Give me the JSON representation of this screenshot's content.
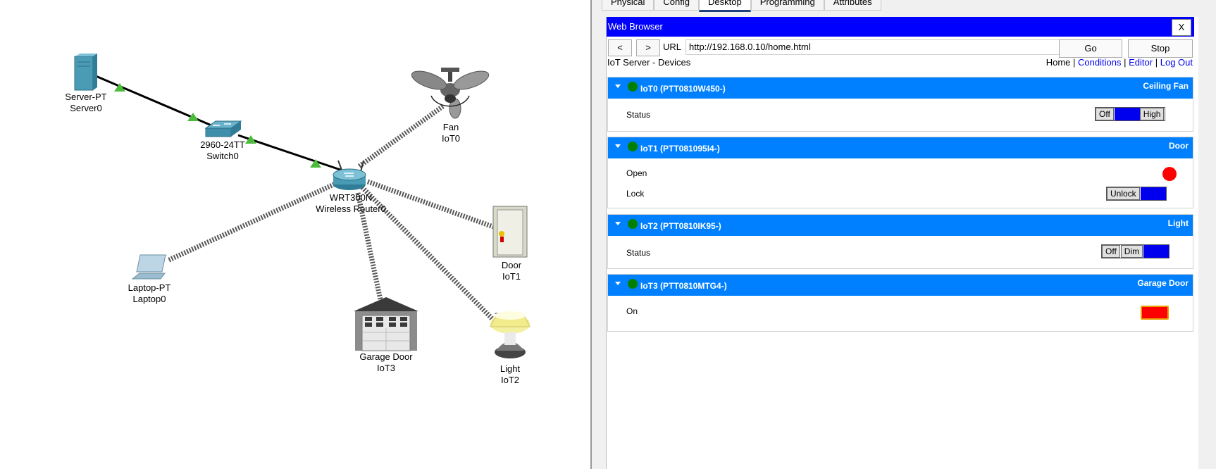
{
  "topology": {
    "devices": [
      {
        "id": "server",
        "model": "Server-PT",
        "name": "Server0"
      },
      {
        "id": "switch",
        "model": "2960-24TT",
        "name": "Switch0"
      },
      {
        "id": "router",
        "model": "WRT300N",
        "name": "Wireless Router0"
      },
      {
        "id": "fan",
        "model": "Fan",
        "name": "IoT0"
      },
      {
        "id": "door",
        "model": "Door",
        "name": "IoT1"
      },
      {
        "id": "light",
        "model": "Light",
        "name": "IoT2"
      },
      {
        "id": "garage",
        "model": "Garage Door",
        "name": "IoT3"
      },
      {
        "id": "laptop",
        "model": "Laptop-PT",
        "name": "Laptop0"
      }
    ],
    "link_up_color": "#4cbb3c"
  },
  "tabs": [
    "Physical",
    "Config",
    "Desktop",
    "Programming",
    "Attributes"
  ],
  "active_tab": "Desktop",
  "browser": {
    "title": "Web Browser",
    "close_label": "X",
    "back_label": "<",
    "forward_label": ">",
    "url_label": "URL",
    "url": "http://192.168.0.10/home.html",
    "go_label": "Go",
    "stop_label": "Stop",
    "title_bar_color": "#0000ff"
  },
  "page": {
    "title": "IoT Server - Devices",
    "links": [
      "Home",
      "Conditions",
      "Editor",
      "Log Out"
    ],
    "separator": "|",
    "header_color": "#0080ff",
    "devices": [
      {
        "name": "IoT0 (PTT0810W450-)",
        "type": "Ceiling Fan",
        "props": [
          {
            "label": "Status",
            "options": [
              "Off",
              "High"
            ]
          }
        ]
      },
      {
        "name": "IoT1 (PTT081095I4-)",
        "type": "Door",
        "props": [
          {
            "label": "Open"
          },
          {
            "label": "Lock",
            "options": [
              "Unlock"
            ]
          }
        ]
      },
      {
        "name": "IoT2 (PTT0810IK95-)",
        "type": "Light",
        "props": [
          {
            "label": "Status",
            "options": [
              "Off",
              "Dim"
            ]
          }
        ]
      },
      {
        "name": "IoT3 (PTT0810MTG4-)",
        "type": "Garage Door",
        "props": [
          {
            "label": "On"
          }
        ]
      }
    ]
  }
}
